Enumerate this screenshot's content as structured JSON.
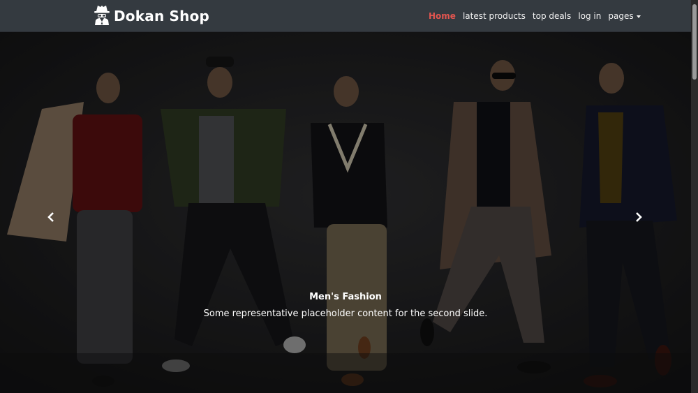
{
  "brand": {
    "name": "Dokan Shop",
    "logo_icon": "spy-icon"
  },
  "nav": {
    "items": [
      {
        "label": "Home",
        "active": true
      },
      {
        "label": "latest products"
      },
      {
        "label": "top deals"
      },
      {
        "label": "log in"
      },
      {
        "label": "pages",
        "dropdown": true
      }
    ]
  },
  "carousel": {
    "caption_title": "Men's Fashion",
    "caption_text": "Some representative placeholder content for the second slide.",
    "prev_icon": "chevron-left-icon",
    "next_icon": "chevron-right-icon"
  },
  "colors": {
    "navbar": "#343a40",
    "active_link": "#e2554f",
    "text": "#ffffff"
  }
}
